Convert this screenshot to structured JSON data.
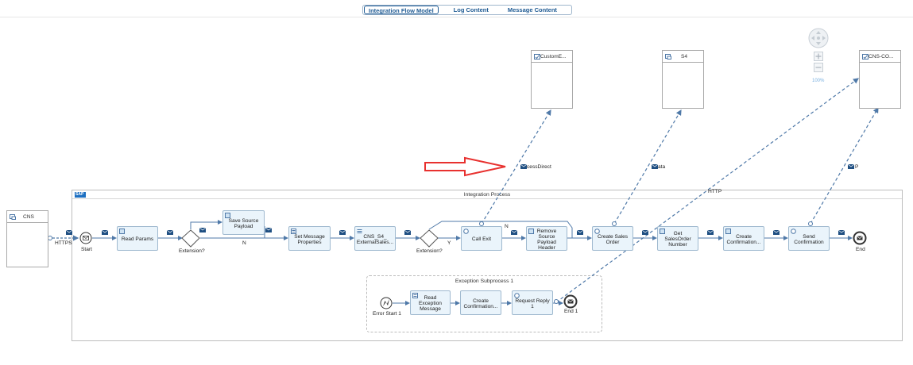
{
  "tabs": [
    {
      "label": "Integration Flow Model",
      "active": true
    },
    {
      "label": "Log Content",
      "active": false
    },
    {
      "label": "Message Content",
      "active": false
    }
  ],
  "pool": {
    "title": "Integration Process"
  },
  "subprocess": {
    "title": "Exception Subprocess 1"
  },
  "participants": {
    "sender": "CNS",
    "receiver1": "CustomE...",
    "receiver2": "S4",
    "receiver3": "CNS-CO..."
  },
  "steps": {
    "read_params": "Read Params",
    "save_source_payload": "Save Source Payload",
    "set_message_properties": "Set Message Properties",
    "cns_s4_external": "CNS_S4_ ExternalSales...",
    "call_exit": "Call Exit",
    "remove_source_payload_header": "Remove Source Payload Header",
    "create_sales_order": "Create Sales Order",
    "get_salesorder_number": "Get SalesOrder Number",
    "create_confirmation": "Create Confirmation...",
    "send_confirmation": "Send Confirmation",
    "read_exception_message": "Read Exception Message",
    "create_confirmation_exc": "Create Confirmation...",
    "request_reply_1": "Request Reply 1"
  },
  "events": {
    "start": "Start",
    "end": "End",
    "error_start": "Error Start 1",
    "end1": "End 1"
  },
  "gateways": {
    "extension1": "Extension?",
    "extension2": "Extension?"
  },
  "flow_labels": {
    "n1": "N",
    "n2": "N",
    "y": "Y"
  },
  "adapters": {
    "https": "HTTPS",
    "process_direct": "cessDirect",
    "odata": "ata",
    "http": "HTTP",
    "p": "P"
  },
  "zoom": "100%",
  "annotation": {
    "arrow_color": "#e8312f"
  },
  "colors": {
    "accent": "#1f5b94",
    "connector": "#4f79a8",
    "task_fill": "#eaf4fb"
  }
}
